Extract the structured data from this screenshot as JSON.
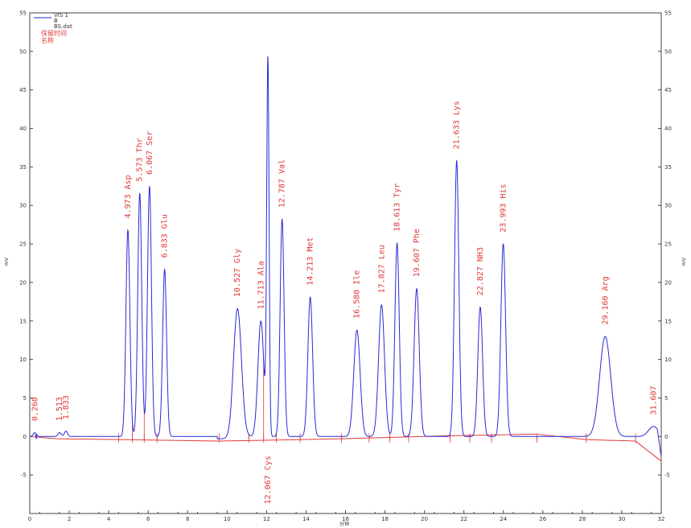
{
  "chart_data": {
    "type": "line",
    "xlabel": "分钟",
    "ylabel_left": "mV",
    "ylabel_right": "mV",
    "xlim": [
      0,
      32
    ],
    "ylim": [
      -10,
      55
    ],
    "x_ticks": [
      0,
      2,
      4,
      6,
      8,
      10,
      12,
      14,
      16,
      18,
      20,
      22,
      24,
      26,
      28,
      30,
      32
    ],
    "y_ticks": [
      -5,
      0,
      5,
      10,
      15,
      20,
      25,
      30,
      35,
      40,
      45,
      50,
      55
    ],
    "grid": false,
    "legend": {
      "placement": "top-left",
      "lines": [
        "VIS 1",
        "B",
        "BS.dat"
      ],
      "annotation_lines": [
        "保留时间",
        "名称"
      ]
    },
    "colors": {
      "trace": "#2a2ad6",
      "baseline": "#e03a3a",
      "labels": "#e03a3a",
      "axis": "#444444"
    },
    "peaks": [
      {
        "rt": 0.26,
        "height": 0.5,
        "label": "0.260",
        "name": ""
      },
      {
        "rt": 1.513,
        "height": 0.5,
        "label": "1.513",
        "name": ""
      },
      {
        "rt": 1.833,
        "height": 0.7,
        "label": "1.833",
        "name": ""
      },
      {
        "rt": 4.973,
        "height": 26.8,
        "label": "4.973",
        "name": "Asp"
      },
      {
        "rt": 5.573,
        "height": 31.6,
        "label": "5.573",
        "name": "Thr"
      },
      {
        "rt": 6.067,
        "height": 32.5,
        "label": "6.067",
        "name": "Ser"
      },
      {
        "rt": 6.833,
        "height": 21.7,
        "label": "6.833",
        "name": "Glu"
      },
      {
        "rt": 10.527,
        "height": 16.6,
        "label": "10.527",
        "name": "Gly"
      },
      {
        "rt": 11.713,
        "height": 15.0,
        "label": "11.713",
        "name": "Ala"
      },
      {
        "rt": 12.067,
        "height": 48.5,
        "label": "12.067",
        "name": "Cys"
      },
      {
        "rt": 12.787,
        "height": 28.2,
        "label": "12.787",
        "name": "Val"
      },
      {
        "rt": 14.213,
        "height": 18.1,
        "label": "14.213",
        "name": "Met"
      },
      {
        "rt": 16.58,
        "height": 13.8,
        "label": "16.580",
        "name": "Ile"
      },
      {
        "rt": 17.827,
        "height": 17.1,
        "label": "17.827",
        "name": "Leu"
      },
      {
        "rt": 18.613,
        "height": 25.1,
        "label": "18.613",
        "name": "Tyr"
      },
      {
        "rt": 19.607,
        "height": 19.2,
        "label": "19.607",
        "name": "Phe"
      },
      {
        "rt": 21.633,
        "height": 35.8,
        "label": "21.633",
        "name": "Lys"
      },
      {
        "rt": 22.827,
        "height": 16.8,
        "label": "22.827",
        "name": "NH3"
      },
      {
        "rt": 23.993,
        "height": 25.0,
        "label": "23.993",
        "name": "His"
      },
      {
        "rt": 29.16,
        "height": 13.0,
        "label": "29.160",
        "name": "Arg"
      },
      {
        "rt": 31.607,
        "height": 1.3,
        "label": "31.607",
        "name": ""
      }
    ]
  }
}
